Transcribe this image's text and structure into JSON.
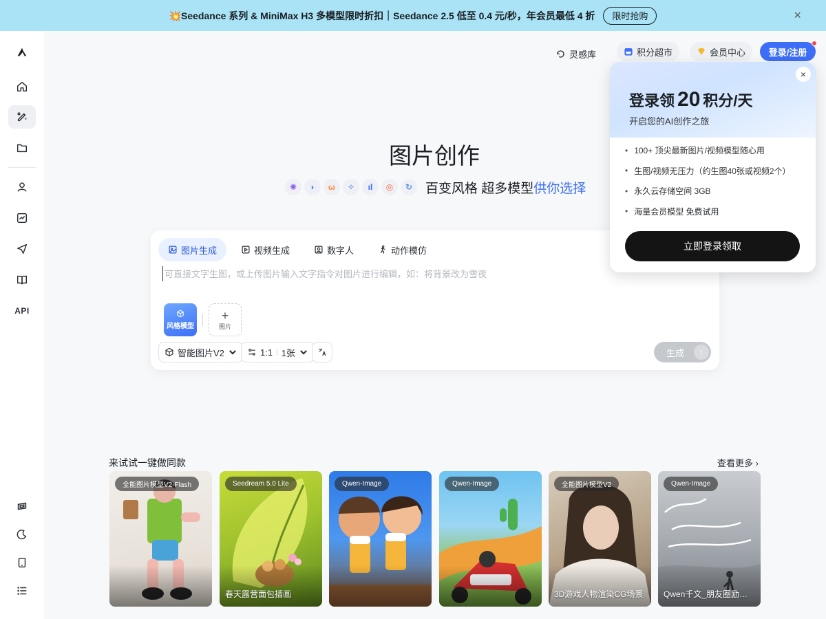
{
  "banner": {
    "text": "💥Seedance 系列 & MiniMax H3 多模型限时折扣｜Seedance 2.5 低至 0.4 元/秒，年会员最低 4 折",
    "cta": "限时抢购",
    "close": "×"
  },
  "sidebar": {
    "api_label": "API"
  },
  "header": {
    "inspiration": "灵感库",
    "points_mall": "积分超市",
    "member_center": "会员中心",
    "login": "登录/注册"
  },
  "main": {
    "title": "图片创作",
    "subtitle_prefix": "百变风格 超多模型",
    "subtitle_accent": "供你选择"
  },
  "composer": {
    "tabs": [
      {
        "label": "图片生成"
      },
      {
        "label": "视频生成"
      },
      {
        "label": "数字人"
      },
      {
        "label": "动作模仿"
      }
    ],
    "placeholder": "可直接文字生图，或上传图片输入文字指令对图片进行编辑，如：将背景改为雪夜",
    "style_tile": "风格模型",
    "image_tile": "图片",
    "model_select": "智能图片V2",
    "ratio": "1:1",
    "count": "1张",
    "generate": "生成"
  },
  "promo": {
    "title_prefix": "登录领",
    "title_number": "20",
    "title_suffix": "积分/天",
    "subtitle": "开启您的AI创作之旅",
    "items": [
      {
        "a": "100+ 顶尖最新图片/视频模型随心用",
        "b": ""
      },
      {
        "a": "生图/视频无压力（约生图40张或视频2个）",
        "b": ""
      },
      {
        "a": "永久云存储空间 3GB",
        "b": ""
      },
      {
        "a": "海量会员模型 ",
        "b": "免费试用"
      }
    ],
    "cta": "立即登录领取",
    "close": "×"
  },
  "gallery": {
    "title": "来试试一键做同款",
    "see_more": "查看更多 ›",
    "cards": [
      {
        "badge": "全能图片模型V2-Flash",
        "label": ""
      },
      {
        "badge": "Seedream 5.0 Lite",
        "label": "春天露营面包插画"
      },
      {
        "badge": "Qwen-Image",
        "label": ""
      },
      {
        "badge": "Qwen-Image",
        "label": ""
      },
      {
        "badge": "全能图片模型V2",
        "label": "3D游戏人物渲染CG场景"
      },
      {
        "badge": "Qwen-Image",
        "label": "Qwen千文_朋友圈励志文案"
      }
    ]
  },
  "colors": {
    "banner_bg": "#a9e3f5",
    "accent_blue": "#3d6ef7",
    "promo_button": "#141414"
  }
}
